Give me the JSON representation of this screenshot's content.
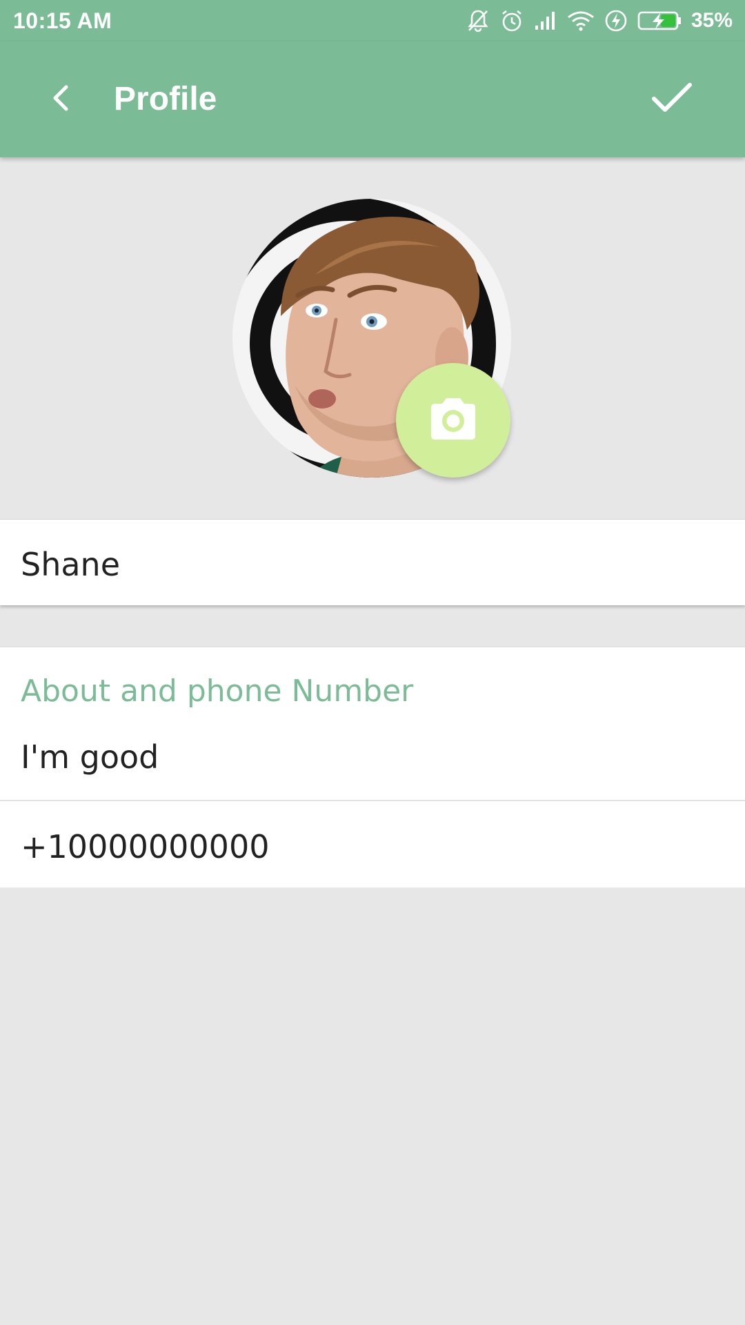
{
  "status_bar": {
    "time": "10:15 AM",
    "battery_percent": "35%",
    "icons": [
      "bell-muted-icon",
      "alarm-icon",
      "signal-icon",
      "wifi-icon",
      "charging-icon",
      "battery-icon"
    ]
  },
  "app_bar": {
    "title": "Profile",
    "back_icon": "chevron-left-icon",
    "confirm_icon": "checkmark-icon",
    "color": "#7bbc97"
  },
  "profile": {
    "avatar_icon": "profile-photo",
    "camera_icon": "camera-icon",
    "camera_color": "#d1ef9b",
    "name": "Shane"
  },
  "about": {
    "header": "About and phone Number",
    "status": "I'm good",
    "phone": "+10000000000",
    "accent_color": "#7bbc97"
  }
}
